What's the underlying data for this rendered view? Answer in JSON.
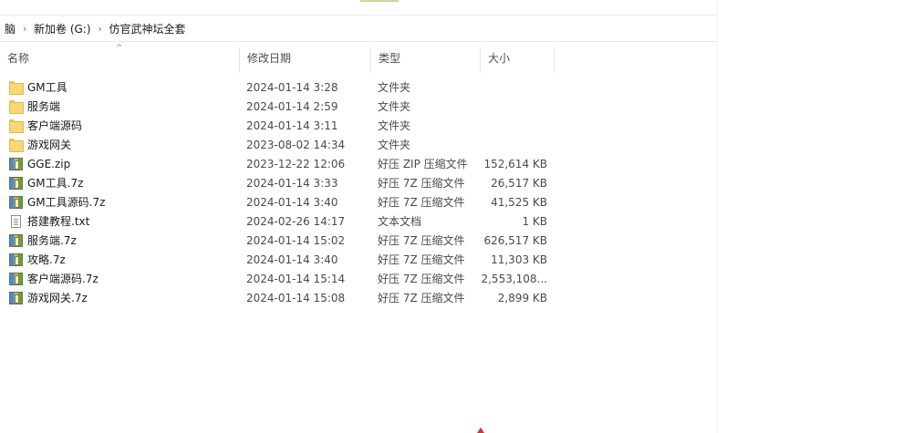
{
  "breadcrumb": {
    "items": [
      "脑",
      "新加卷 (G:)",
      "仿官武神坛全套"
    ]
  },
  "columns": {
    "name": "名称",
    "date": "修改日期",
    "type": "类型",
    "size": "大小"
  },
  "files": [
    {
      "icon": "folder-icon",
      "name": "GM工具",
      "date": "2024-01-14 3:28",
      "type": "文件夹",
      "size": ""
    },
    {
      "icon": "folder-icon",
      "name": "服务端",
      "date": "2024-01-14 2:59",
      "type": "文件夹",
      "size": ""
    },
    {
      "icon": "folder-icon",
      "name": "客户端源码",
      "date": "2024-01-14 3:11",
      "type": "文件夹",
      "size": ""
    },
    {
      "icon": "folder-icon",
      "name": "游戏网关",
      "date": "2023-08-02 14:34",
      "type": "文件夹",
      "size": ""
    },
    {
      "icon": "archive-icon",
      "name": "GGE.zip",
      "date": "2023-12-22 12:06",
      "type": "好压 ZIP 压缩文件",
      "size": "152,614 KB"
    },
    {
      "icon": "archive-icon",
      "name": "GM工具.7z",
      "date": "2024-01-14 3:33",
      "type": "好压 7Z 压缩文件",
      "size": "26,517 KB"
    },
    {
      "icon": "archive-icon",
      "name": "GM工具源码.7z",
      "date": "2024-01-14 3:40",
      "type": "好压 7Z 压缩文件",
      "size": "41,525 KB"
    },
    {
      "icon": "text-file-icon",
      "name": "搭建教程.txt",
      "date": "2024-02-26 14:17",
      "type": "文本文档",
      "size": "1 KB"
    },
    {
      "icon": "archive-icon",
      "name": "服务端.7z",
      "date": "2024-01-14 15:02",
      "type": "好压 7Z 压缩文件",
      "size": "626,517 KB"
    },
    {
      "icon": "archive-icon",
      "name": "攻略.7z",
      "date": "2024-01-14 3:40",
      "type": "好压 7Z 压缩文件",
      "size": "11,303 KB"
    },
    {
      "icon": "archive-icon",
      "name": "客户端源码.7z",
      "date": "2024-01-14 15:14",
      "type": "好压 7Z 压缩文件",
      "size": "2,553,108..."
    },
    {
      "icon": "archive-icon",
      "name": "游戏网关.7z",
      "date": "2024-01-14 15:08",
      "type": "好压 7Z 压缩文件",
      "size": "2,899 KB"
    }
  ],
  "colors": {
    "folder": "#f8d775",
    "header_text": "#4d4d4d",
    "accent_mark": "#d9322a"
  }
}
